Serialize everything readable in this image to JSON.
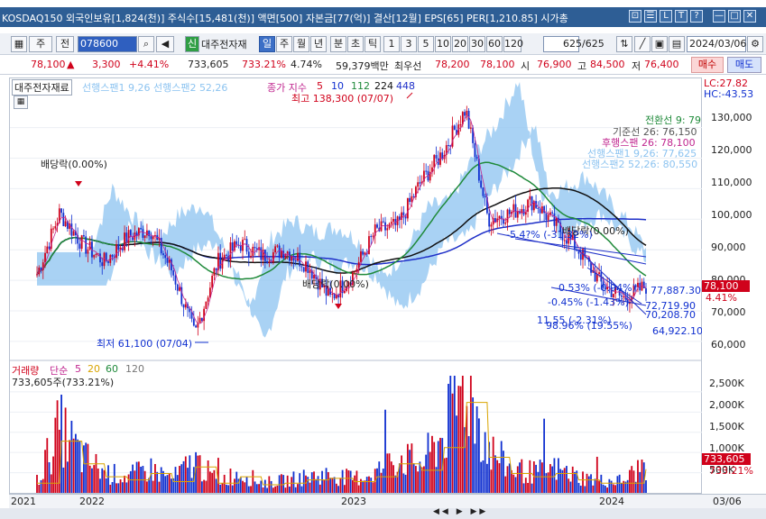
{
  "titlebar": {
    "text": "KOSDAQ150 외국인보유[1,824(천)] 주식수[15,481(천)] 액면[500] 자본금[77(억)] 결산[12월] EPS[65] PER[1,210.85] 시가총",
    "buttons": [
      "⊡",
      "☰",
      "L",
      "T",
      "?",
      "—",
      "□",
      "✕"
    ]
  },
  "toolbar": {
    "market": "주",
    "market2": "전",
    "code": "078600",
    "stock_tag": "신",
    "stock_name": "대주전자재",
    "periods": [
      "일",
      "주",
      "월",
      "년",
      "분",
      "초",
      "틱"
    ],
    "selected_period": "일",
    "intervals": [
      "1",
      "3",
      "5",
      "10",
      "20",
      "30",
      "60",
      "120"
    ],
    "count": "625/625",
    "date": "2024/03/06"
  },
  "quote": {
    "price": "78,100",
    "arrow": "▲",
    "change": "3,300",
    "change_pct": "+4.41%",
    "volume": "733,605",
    "volume_ratio": "733.21%",
    "turnover": "4.74%",
    "amount": "59,379백만",
    "ask_label": "최우선",
    "ask": "78,200",
    "bid": "78,100",
    "open_label": "시",
    "open": "76,900",
    "high_label": "고",
    "high": "84,500",
    "low_label": "저",
    "low": "76,400",
    "buy_button": "매수",
    "sell_button": "매도"
  },
  "price_pane": {
    "stock_label": "대주전자재료",
    "ichimoku_legend": "선행스팬1 9,26  선행스팬2 52,26",
    "ma_legend_prefix": "종가 지수",
    "ma_periods": [
      "5",
      "10",
      "112",
      "224",
      "448"
    ],
    "max_label": "최고 138,300 (07/07)",
    "min_label": "최저 61,100 (07/04)",
    "dividend_labels": [
      "배당락(0.00%)",
      "배당락(0.00%)",
      "배당락(0.00%)"
    ],
    "ichimoku_values": [
      {
        "text": "전환선 9: 79,100",
        "color": "#1f8a3a"
      },
      {
        "text": "기준선 26: 76,150",
        "color": "#555555"
      },
      {
        "text": "후행스팬 26: 78,100",
        "color": "#c0268f"
      },
      {
        "text": "선행스팬1 9,26: 77,625",
        "color": "#8cc3f0"
      },
      {
        "text": "선행스팬2 52,26: 80,550",
        "color": "#8cc3f0"
      }
    ],
    "trend_labels": [
      "-5.4?% (-31.32%)",
      "-0.53% (-0.94%)",
      "-0.45% (-1.43%)",
      "11.55 (-2.31%)",
      "98.96% (19.55%)"
    ],
    "price_marks": [
      "77,887.30",
      "72,719.90",
      "70,208.70",
      "64,922.10"
    ],
    "lc": "LC:27.82",
    "hc": "HC:-43.53",
    "y_ticks": [
      "130,000",
      "120,000",
      "110,000",
      "100,000",
      "90,000",
      "80,000",
      "70,000",
      "60,000"
    ],
    "last_price": "78,100",
    "last_pct": "4.41%"
  },
  "volume_pane": {
    "label": "거래량",
    "ma_prefix": "단순",
    "ma_periods": [
      "5",
      "20",
      "60",
      "120"
    ],
    "current": "733,605주(733.21%)",
    "y_ticks": [
      "2,500K",
      "2,000K",
      "1,500K",
      "1,000K",
      "500K"
    ],
    "last_value": "733,605",
    "last_pct": "733.21%"
  },
  "x_axis": {
    "labels": [
      "2021",
      "2022",
      "2023",
      "2024"
    ],
    "end_label": "03/06"
  },
  "colors": {
    "up": "#d0021b",
    "down": "#1030d0",
    "ma_green": "#1f8a3a",
    "ma_black": "#111111",
    "ma_blue": "#1e2fc8",
    "cloud": "#8cc3f0",
    "title_bg": "#2e5e95"
  },
  "chart_data": {
    "type": "candlestick",
    "x_range": [
      "2021-12",
      "2024-03-06"
    ],
    "ylim": [
      57000,
      142000
    ],
    "close_series": [
      {
        "date": "2021-12",
        "value": 82000
      },
      {
        "date": "2022-01",
        "value": 102000
      },
      {
        "date": "2022-02",
        "value": 92000
      },
      {
        "date": "2022-03",
        "value": 86000
      },
      {
        "date": "2022-04",
        "value": 94000
      },
      {
        "date": "2022-05",
        "value": 97000
      },
      {
        "date": "2022-06",
        "value": 83000
      },
      {
        "date": "2022-07",
        "value": 62000
      },
      {
        "date": "2022-08",
        "value": 86000
      },
      {
        "date": "2022-09",
        "value": 92000
      },
      {
        "date": "2022-10",
        "value": 88000
      },
      {
        "date": "2022-11",
        "value": 90000
      },
      {
        "date": "2022-12",
        "value": 85000
      },
      {
        "date": "2023-01",
        "value": 74000
      },
      {
        "date": "2023-02",
        "value": 82000
      },
      {
        "date": "2023-03",
        "value": 96000
      },
      {
        "date": "2023-04",
        "value": 98000
      },
      {
        "date": "2023-05",
        "value": 112000
      },
      {
        "date": "2023-06",
        "value": 122000
      },
      {
        "date": "2023-07",
        "value": 136000
      },
      {
        "date": "2023-08",
        "value": 100000
      },
      {
        "date": "2023-09",
        "value": 102000
      },
      {
        "date": "2023-10",
        "value": 106000
      },
      {
        "date": "2023-11",
        "value": 98000
      },
      {
        "date": "2023-12",
        "value": 90000
      },
      {
        "date": "2024-01",
        "value": 79000
      },
      {
        "date": "2024-02",
        "value": 74000
      },
      {
        "date": "2024-03",
        "value": 78100
      }
    ],
    "volume_series_k": [
      300,
      1600,
      900,
      500,
      400,
      600,
      350,
      800,
      300,
      500,
      250,
      300,
      400,
      450,
      350,
      500,
      900,
      700,
      1400,
      2800,
      1100,
      600,
      500,
      600,
      400,
      300,
      300,
      733.6
    ],
    "volume_ylim_k": [
      0,
      2900
    ]
  }
}
